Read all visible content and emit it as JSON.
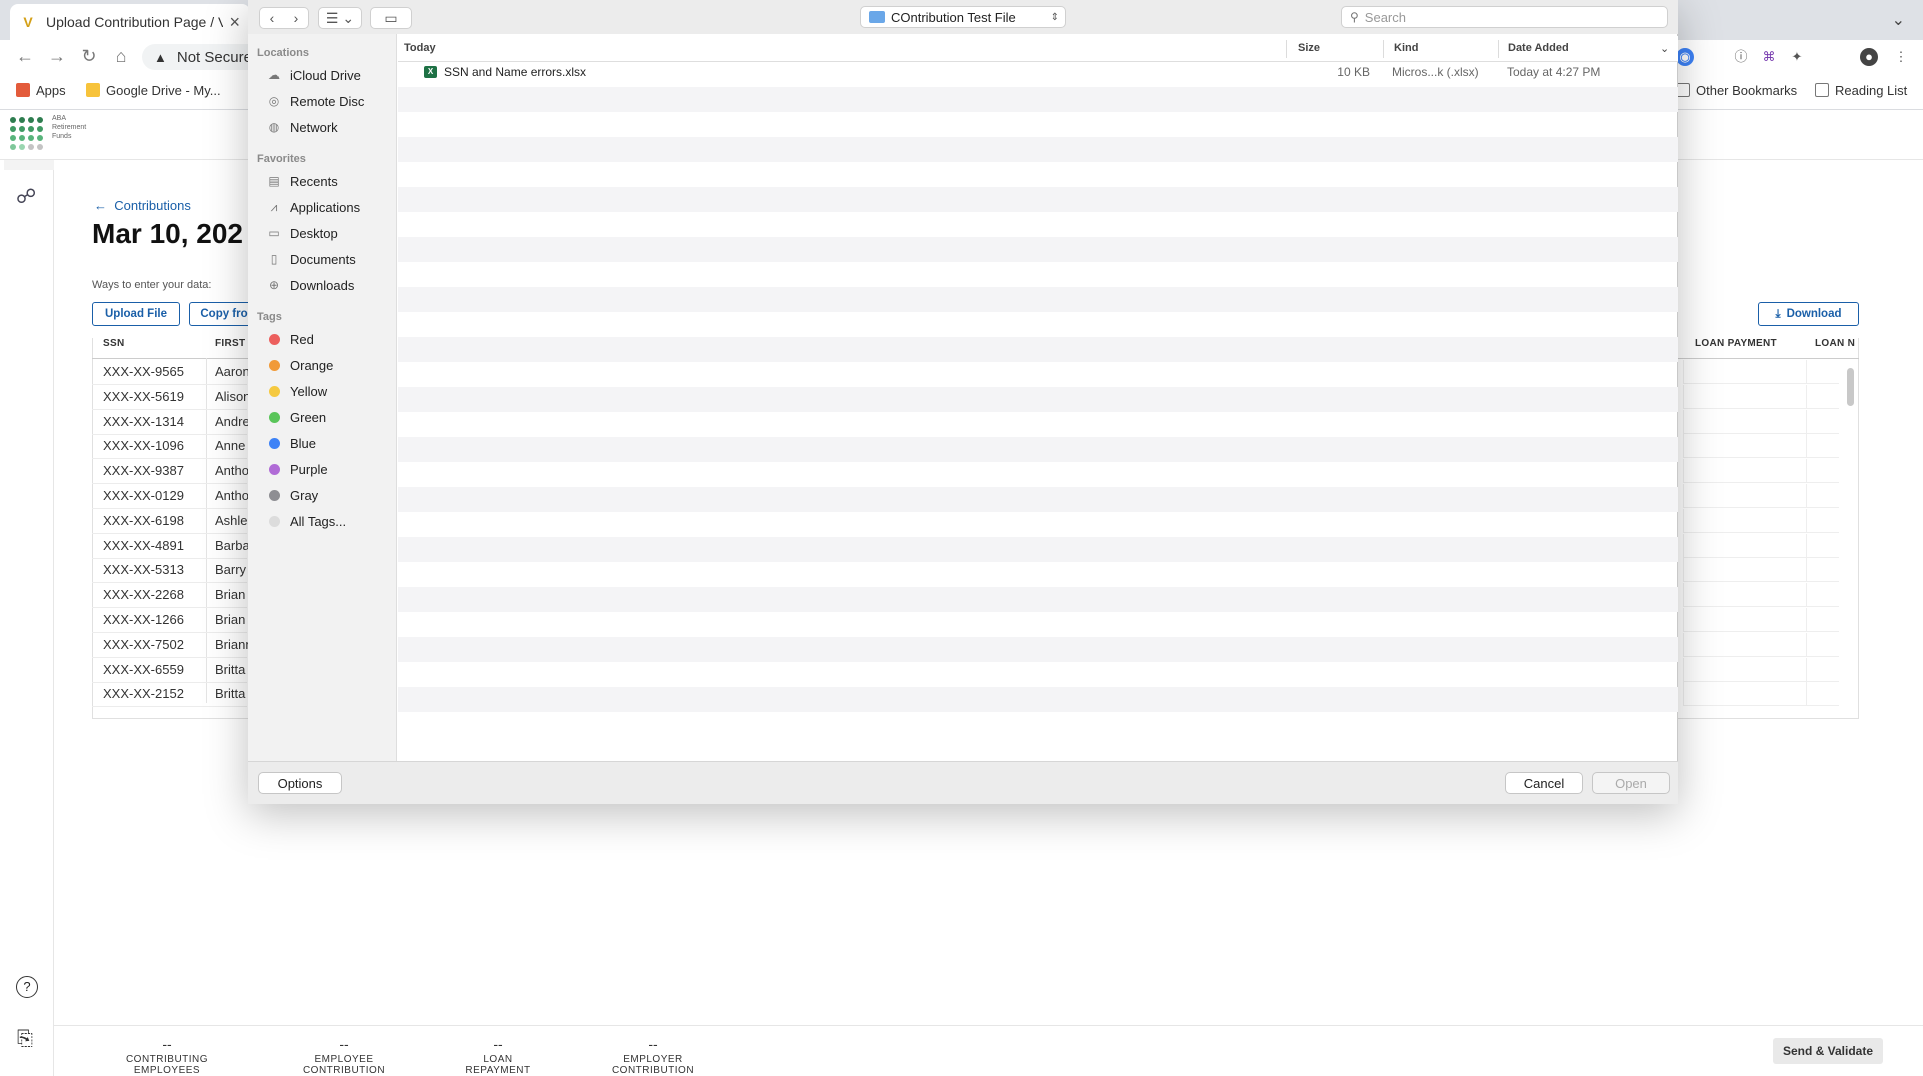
{
  "browser": {
    "tab_title": "Upload Contribution Page / Ve",
    "address": "Not Secure",
    "bookmarks": [
      "Apps",
      "Google Drive - My...",
      "Other Bookmarks",
      "Reading List"
    ]
  },
  "app": {
    "logo_text": [
      "ABA",
      "Retirement",
      "Funds"
    ],
    "back_link": "Contributions",
    "page_title": "Mar 10, 202",
    "ways_label": "Ways to enter your data:",
    "upload_button": "Upload File",
    "copy_button": "Copy fro",
    "download_button": "Download",
    "columns": {
      "ssn": "SSN",
      "first": "FIRST",
      "loan_payment": "LOAN PAYMENT",
      "loan_number": "LOAN N"
    },
    "rows": [
      {
        "ssn": "XXX-XX-9565",
        "first": "Aaron"
      },
      {
        "ssn": "XXX-XX-5619",
        "first": "Alison"
      },
      {
        "ssn": "XXX-XX-1314",
        "first": "Andre"
      },
      {
        "ssn": "XXX-XX-1096",
        "first": "Anne"
      },
      {
        "ssn": "XXX-XX-9387",
        "first": "Antho"
      },
      {
        "ssn": "XXX-XX-0129",
        "first": "Antho"
      },
      {
        "ssn": "XXX-XX-6198",
        "first": "Ashle"
      },
      {
        "ssn": "XXX-XX-4891",
        "first": "Barba"
      },
      {
        "ssn": "XXX-XX-5313",
        "first": "Barry"
      },
      {
        "ssn": "XXX-XX-2268",
        "first": "Brian"
      },
      {
        "ssn": "XXX-XX-1266",
        "first": "Brian"
      },
      {
        "ssn": "XXX-XX-7502",
        "first": "Briann"
      },
      {
        "ssn": "XXX-XX-6559",
        "first": "Britta"
      },
      {
        "ssn": "XXX-XX-2152",
        "first": "Britta"
      }
    ],
    "footer": {
      "stats": [
        {
          "value": "--",
          "label": "CONTRIBUTING EMPLOYEES"
        },
        {
          "value": "--",
          "label": "EMPLOYEE CONTRIBUTION"
        },
        {
          "value": "--",
          "label": "LOAN REPAYMENT"
        },
        {
          "value": "--",
          "label": "EMPLOYER CONTRIBUTION"
        }
      ],
      "send_button": "Send & Validate"
    }
  },
  "dialog": {
    "folder": "COntribution Test File",
    "search_placeholder": "Search",
    "sidebar": {
      "locations_heading": "Locations",
      "locations": [
        "iCloud Drive",
        "Remote Disc",
        "Network"
      ],
      "favorites_heading": "Favorites",
      "favorites": [
        "Recents",
        "Applications",
        "Desktop",
        "Documents",
        "Downloads"
      ],
      "tags_heading": "Tags",
      "tags": [
        {
          "name": "Red",
          "color": "#ec5f5d"
        },
        {
          "name": "Orange",
          "color": "#f19a38"
        },
        {
          "name": "Yellow",
          "color": "#f5c940"
        },
        {
          "name": "Green",
          "color": "#5ac55a"
        },
        {
          "name": "Blue",
          "color": "#3d82f6"
        },
        {
          "name": "Purple",
          "color": "#b06bd6"
        },
        {
          "name": "Gray",
          "color": "#8e8e93"
        },
        {
          "name": "All Tags...",
          "color": "#dcdcdc"
        }
      ]
    },
    "list_headers": {
      "name": "Today",
      "size": "Size",
      "kind": "Kind",
      "date": "Date Added"
    },
    "files": [
      {
        "name": "SSN and Name errors.xlsx",
        "size": "10 KB",
        "kind": "Micros...k (.xlsx)",
        "date": "Today at 4:27 PM"
      }
    ],
    "options_button": "Options",
    "cancel_button": "Cancel",
    "open_button": "Open"
  },
  "colors": {
    "accent": "#1a5fa8",
    "excel": "#1e7145"
  }
}
